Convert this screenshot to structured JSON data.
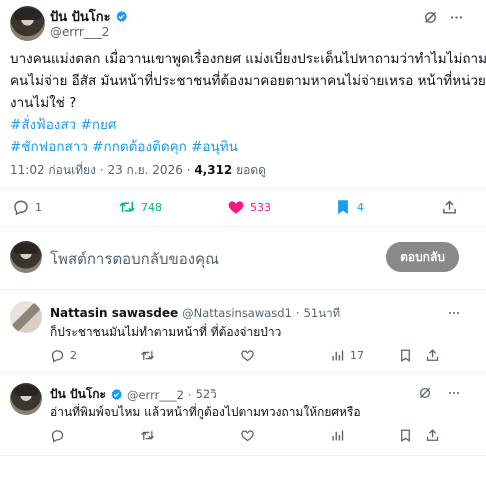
{
  "tweet": {
    "author_name": "ปัน ปันโกะ",
    "author_handle": "@errr___2",
    "body_lines": [
      "บางคนแม่งตลก เมื่อวานเขาพูดเรื่องกยศ แม่งเบี่ยงประเด็นไปหาถามว่าทำไมไม่ถาม",
      "คนไม่จ่าย อีสัส มันหน้าที่ประชาชนที่ต้องมาคอยตามหาคนไม่จ่ายเหรอ หน้าที่หน่วย",
      "งานไม่ใช่ ?"
    ],
    "hashtag_line_1": "#สั่งฟ้องสว #กยศ",
    "hashtag_line_2": "#ชักฟอกสาว #กกตต้องติดคุก #อนุทิน",
    "time": "11:02 ก่อนเที่ยง",
    "sep": "·",
    "date": "23 ก.ย. 2026",
    "views_count": "4,312",
    "views_label": "ยอดดู",
    "stats": {
      "replies": "1",
      "reposts": "748",
      "likes": "533",
      "bookmarks": "4"
    }
  },
  "composer": {
    "placeholder": "โพสต์การตอบกลับของคุณ",
    "button_label": "ตอบกลับ"
  },
  "replies": [
    {
      "name": "Nattasin sawasdee",
      "handle": "@Nattasinsawasd1",
      "dot": "·",
      "time": "51นาที",
      "text": "ก็ประชาชนมันไม่ทำตามหน้าที่ ที่ต้องจ่ายป่าว",
      "replies": "2",
      "views": "17"
    },
    {
      "name": "ปัน ปันโกะ",
      "handle": "@errr___2",
      "dot": "·",
      "time": "52วิ",
      "text": "อ่านที่พิมพ์จบไหม แล้วหน้าที่กูต้องไปตามทวงถามให้กยศหรือ"
    }
  ],
  "colors": {
    "accent": "#1d9bf0",
    "repost": "#00ba7c",
    "like": "#f91880",
    "text": "#0f1419",
    "muted": "#536471"
  }
}
